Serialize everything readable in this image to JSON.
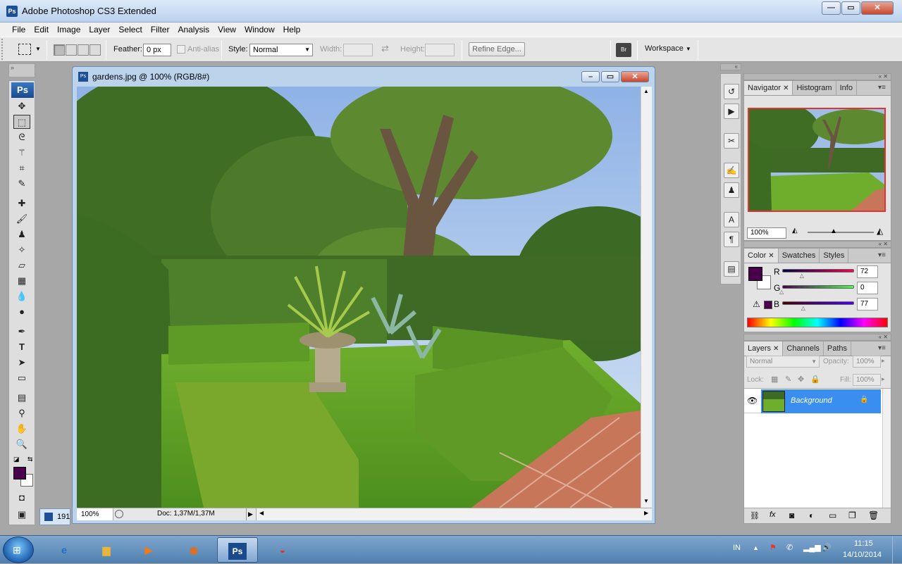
{
  "app": {
    "title": "Adobe Photoshop CS3 Extended",
    "ps_badge": "Ps"
  },
  "menu": [
    "File",
    "Edit",
    "Image",
    "Layer",
    "Select",
    "Filter",
    "Analysis",
    "View",
    "Window",
    "Help"
  ],
  "options": {
    "feather_label": "Feather:",
    "feather_value": "0 px",
    "antialias_label": "Anti-alias",
    "style_label": "Style:",
    "style_value": "Normal",
    "width_label": "Width:",
    "height_label": "Height:",
    "refine_edge": "Refine Edge...",
    "workspace": "Workspace"
  },
  "document": {
    "title": "gardens.jpg @ 100% (RGB/8#)",
    "zoom": "100%",
    "doc_info": "Doc: 1,37M/1,37M",
    "minimized_label": "191"
  },
  "navigator": {
    "tabs": [
      "Navigator",
      "Histogram",
      "Info"
    ],
    "zoom": "100%"
  },
  "color": {
    "tabs": [
      "Color",
      "Swatches",
      "Styles"
    ],
    "channels": [
      {
        "label": "R",
        "value": "72",
        "pos": 72
      },
      {
        "label": "G",
        "value": "0",
        "pos": 0
      },
      {
        "label": "B",
        "value": "77",
        "pos": 77
      }
    ],
    "foreground": "#48004d",
    "background": "#ffffff"
  },
  "layers": {
    "tabs": [
      "Layers",
      "Channels",
      "Paths"
    ],
    "blend_mode": "Normal",
    "opacity_label": "Opacity:",
    "opacity_value": "100%",
    "lock_label": "Lock:",
    "fill_label": "Fill:",
    "fill_value": "100%",
    "items": [
      {
        "name": "Background",
        "visible": true,
        "locked": true
      }
    ]
  },
  "taskbar": {
    "lang": "IN",
    "time": "11:15",
    "date": "14/10/2014",
    "ps_label": "Ps"
  },
  "colors": {
    "accent": "#3399ff",
    "layer_selected": "#3a8ef0"
  }
}
